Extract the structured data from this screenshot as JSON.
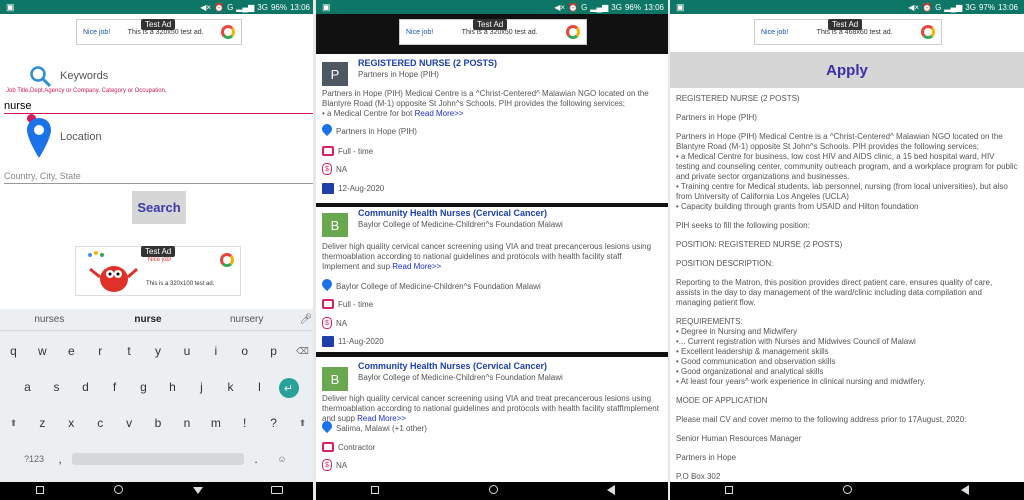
{
  "status": {
    "screen1": {
      "battery": "96%",
      "time": "13:06",
      "network": "3G"
    },
    "screen2": {
      "battery": "96%",
      "time": "13:06",
      "network": "3G"
    },
    "screen3": {
      "battery": "97%",
      "time": "13:06",
      "network": "3G"
    }
  },
  "ads": {
    "label": "Test Ad",
    "nice": "Nice job!",
    "banner1": "This is a 320x50 test ad.",
    "banner2": "This is a 320x50 test ad.",
    "banner3": "This is a 468x60 test ad.",
    "box": "This is a 320x100 test ad.",
    "box_nice": "Nice job!"
  },
  "search_screen": {
    "keywords_label": "Keywords",
    "keywords_hint": "Job Title,Dept,Agency or Company, Category or Occupation,",
    "keywords_value": "nurse",
    "location_label": "Location",
    "location_placeholder": "Country, City, State",
    "search_button": "Search"
  },
  "keyboard": {
    "suggestions": [
      "nurses",
      "nurse",
      "nursery"
    ],
    "row1": [
      "q",
      "w",
      "e",
      "r",
      "t",
      "y",
      "u",
      "i",
      "o",
      "p"
    ],
    "row2": [
      "a",
      "s",
      "d",
      "f",
      "g",
      "h",
      "j",
      "k",
      "l"
    ],
    "row3": [
      "z",
      "x",
      "c",
      "v",
      "b",
      "n",
      "m"
    ],
    "symbols_key": "?123",
    "comma_key": ",",
    "period_key": "."
  },
  "jobs": [
    {
      "avatar": "P",
      "avatar_color": "#4d5863",
      "title": "REGISTERED NURSE (2 POSTS)",
      "org": "Partners in Hope (PIH)",
      "desc": "Partners in Hope (PIH) Medical Centre is a ^Christ-Centered^ Malawian NGO located on the Blantyre Road (M-1) opposite St John^s Schools. PIH provides the following services;",
      "desc2": "• a Medical Centre for bot",
      "read_more": "Read More>>",
      "location": "Partners in Hope (PIH)",
      "type": "Full - time",
      "salary": "NA",
      "date": "12-Aug-2020"
    },
    {
      "avatar": "B",
      "avatar_color": "#6aa84f",
      "title": "Community Health Nurses (Cervical Cancer)",
      "org": "Baylor College of Medicine-Children^s Foundation Malawi",
      "desc": "Deliver high quality cervical cancer screening using VIA and treat precancerous lesions using thermoablation according to national guidelines and protocols with health facility staff",
      "desc2": "Implement and sup",
      "read_more": "Read More>>",
      "location": "Baylor College of Medicine-Children^s Foundation Malawi",
      "type": "Full - time",
      "salary": "NA",
      "date": "11-Aug-2020"
    },
    {
      "avatar": "B",
      "avatar_color": "#6aa84f",
      "title": "Community Health Nurses (Cervical Cancer)",
      "org": "Baylor College of Medicine-Children^s Foundation Malawi",
      "desc": "Deliver high quality cervical cancer screening using VIA and treat precancerous lesions using thermoablation according to national guidelines and protocols with health facility staffImplement and supp",
      "desc2": "",
      "read_more": "Read More>>",
      "location": "Salima, Malawi (+1 other)",
      "type": "Contractor",
      "salary": "NA",
      "date": ""
    }
  ],
  "detail": {
    "apply_button": "Apply",
    "paragraphs": [
      "REGISTERED NURSE (2 POSTS)",
      "Partners in Hope (PIH)",
      "Partners in Hope (PIH) Medical Centre is a ^Christ-Centered^ Malawian NGO located on the Blantyre Road (M-1) opposite St John^s Schools. PIH provides the following services;\n• a Medical Centre for business, low cost HIV and AIDS clinic, a 15 bed hospital ward, HIV testing and counseling center, community outreach program, and a workplace program for public and private sector organizations and businesses.\n• Training centre for Medical students, lab personnel, nursing (from local universities), but also from University of California Los Angeles (UCLA)\n• Capacity building through grants from USAID and Hilton foundation",
      "PIH seeks to fill the following position:",
      "POSITION: REGISTERED NURSE (2 POSTS)",
      "POSITION DESCRIPTION:",
      "Reporting to the Matron, this position provides direct patient care, ensures quality of care, assists in the day to day management of the ward/clinic including data compilation and managing patient flow.",
      "REQUIREMENTS:\n• Degree in Nursing and Midwifery\n•... Current registration with Nurses and Midwives Council of Malawi\n• Excellent leadership & management skills\n• Good communication and observation skills\n• Good organizational and analytical skills\n• At least four years^ work experience in clinical nursing and midwifery.",
      "MODE OF APPLICATION",
      "Please mail CV and cover memo to the following address prior to 17August, 2020:",
      "Senior Human Resources Manager",
      "Partners in Hope",
      "P.O Box 302"
    ]
  },
  "colors": {
    "status_bar": "#0e7667",
    "accent_pink": "#d21a5a",
    "link_blue": "#1b3fb0",
    "button_text": "#3a3aad"
  }
}
